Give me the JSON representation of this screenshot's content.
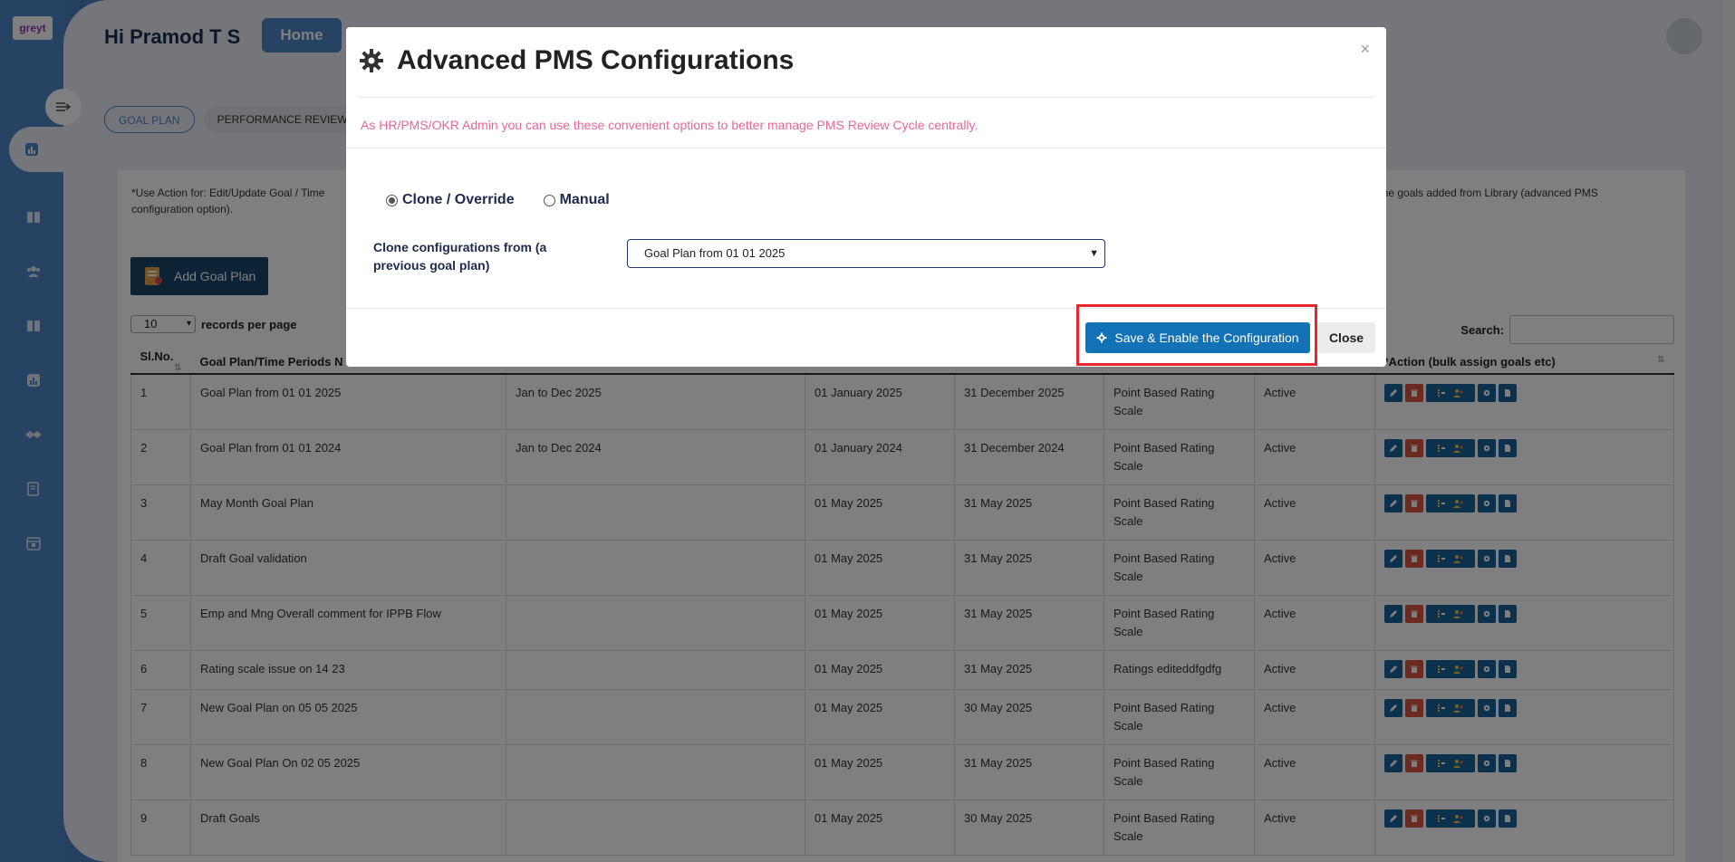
{
  "app": {
    "logo_text": "greyt",
    "greeting": "Hi Pramod T S",
    "home_label": "Home"
  },
  "tabs": [
    {
      "label": "GOAL PLAN",
      "active": true
    },
    {
      "label": "PERFORMANCE REVIEW CY",
      "active": false
    }
  ],
  "card": {
    "note_left": "*Use Action for: Edit/Update Goal / Time",
    "note_left_2": "configuration option).",
    "note_right": "r the goals added from Library (advanced PMS",
    "add_button": "Add Goal Plan",
    "page_size": "10",
    "records_label": "records per page",
    "search_label": "Search:"
  },
  "table": {
    "headers": [
      "Sl.No.",
      "Goal Plan/Time Periods N",
      "",
      "",
      "",
      "",
      "",
      "*Action (bulk assign goals etc)"
    ],
    "rows": [
      {
        "no": "1",
        "name": "Goal Plan from 01 01 2025",
        "period": "Jan to Dec 2025",
        "start": "01 January 2025",
        "end": "31 December 2025",
        "scale": "Point Based Rating Scale",
        "status": "Active"
      },
      {
        "no": "2",
        "name": "Goal Plan from 01 01 2024",
        "period": "Jan to Dec 2024",
        "start": "01 January 2024",
        "end": "31 December 2024",
        "scale": "Point Based Rating Scale",
        "status": "Active"
      },
      {
        "no": "3",
        "name": "May Month Goal Plan",
        "period": "",
        "start": "01 May 2025",
        "end": "31 May 2025",
        "scale": "Point Based Rating Scale",
        "status": "Active"
      },
      {
        "no": "4",
        "name": "Draft Goal validation",
        "period": "",
        "start": "01 May 2025",
        "end": "31 May 2025",
        "scale": "Point Based Rating Scale",
        "status": "Active"
      },
      {
        "no": "5",
        "name": "Emp and Mng Overall comment for IPPB Flow",
        "period": "",
        "start": "01 May 2025",
        "end": "31 May 2025",
        "scale": "Point Based Rating Scale",
        "status": "Active"
      },
      {
        "no": "6",
        "name": "Rating scale issue on 14 23",
        "period": "",
        "start": "01 May 2025",
        "end": "31 May 2025",
        "scale": "Ratings editeddfgdfg",
        "status": "Active"
      },
      {
        "no": "7",
        "name": "New Goal Plan on 05 05 2025",
        "period": "",
        "start": "01 May 2025",
        "end": "30 May 2025",
        "scale": "Point Based Rating Scale",
        "status": "Active"
      },
      {
        "no": "8",
        "name": "New Goal Plan On 02 05 2025",
        "period": "",
        "start": "01 May 2025",
        "end": "31 May 2025",
        "scale": "Point Based Rating Scale",
        "status": "Active"
      },
      {
        "no": "9",
        "name": "Draft Goals",
        "period": "",
        "start": "01 May 2025",
        "end": "30 May 2025",
        "scale": "Point Based Rating Scale",
        "status": "Active"
      }
    ]
  },
  "modal": {
    "title": "Advanced PMS Configurations",
    "close_x": "×",
    "subtitle": "As HR/PMS/OKR Admin you can use these convenient options to better manage PMS Review Cycle centrally.",
    "radio_clone": "Clone / Override",
    "radio_manual": "Manual",
    "clone_label": "Clone configurations from (a previous goal plan)",
    "clone_value": "Goal Plan from 01 01 2025",
    "save_label": "Save & Enable the Configuration",
    "close_label": "Close"
  },
  "colors": {
    "sidebar": "#4f86c6",
    "primary_button": "#1372b6",
    "highlight": "#e8262b",
    "subtitle": "#e8679a"
  }
}
